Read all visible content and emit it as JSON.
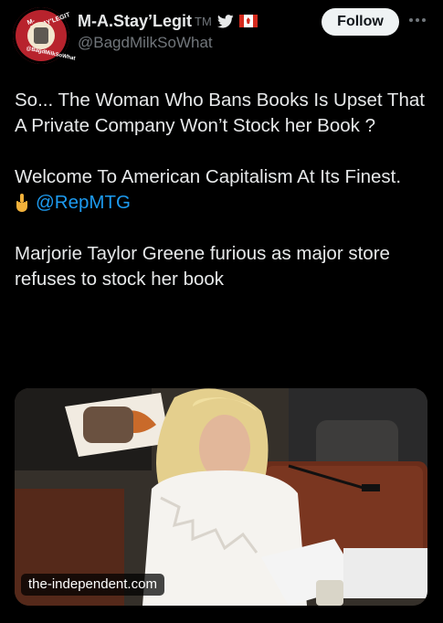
{
  "author": {
    "display_name": "M-A.Stay’Legit",
    "tm": "TM",
    "handle": "@BagdMilkSoWhat",
    "avatar_text_top": "M-A.STAY'LEGIT",
    "avatar_text_bottom": "@BagdMilkSoWhat",
    "icons": [
      "bird-icon",
      "canada-flag-icon"
    ]
  },
  "follow_label": "Follow",
  "tweet": {
    "line1": "So... The Woman Who Bans Books Is Upset That A Private Company Won’t Stock her Book ?",
    "line2": "Welcome To American Capitalism At Its Finest.",
    "mention": "@RepMTG",
    "link_headline": "Marjorie Taylor Greene furious as major store refuses to stock her book"
  },
  "media": {
    "source": "the-independent.com"
  },
  "colors": {
    "background": "#000000",
    "text": "#e7e9ea",
    "muted": "#71767b",
    "link": "#1d9bf0",
    "follow_bg": "#eff3f4"
  }
}
